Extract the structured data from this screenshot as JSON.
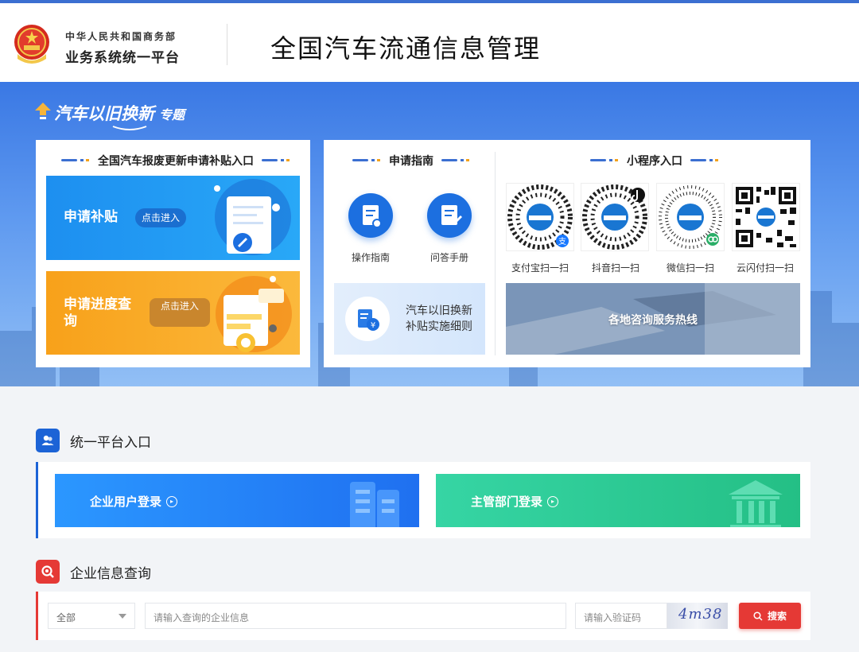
{
  "header": {
    "ministry": "中华人民共和国商务部",
    "platform": "业务系统统一平台",
    "system_title": "全国汽车流通信息管理"
  },
  "banner": {
    "special_title": "汽车以旧换新",
    "special_suffix": "专题",
    "subsidy_section": {
      "title": "全国汽车报废更新申请补贴入口",
      "apply": {
        "label": "申请补贴",
        "action": "点击进入"
      },
      "progress": {
        "label": "申请进度查询",
        "action": "点击进入"
      }
    },
    "guide_section": {
      "title": "申请指南",
      "items": [
        {
          "label": "操作指南",
          "icon": "document-badge-icon"
        },
        {
          "label": "问答手册",
          "icon": "pencil-document-icon"
        }
      ],
      "rules": "汽车以旧换新补贴实施细则"
    },
    "miniapp_section": {
      "title": "小程序入口",
      "items": [
        {
          "label": "支付宝扫一扫",
          "badge_color": "#1677ff"
        },
        {
          "label": "抖音扫一扫",
          "badge_color": "#111111"
        },
        {
          "label": "微信扫一扫",
          "badge_color": "#2aae67"
        },
        {
          "label": "云闪付扫一扫",
          "badge_color": ""
        }
      ],
      "hotline": "各地咨询服务热线"
    }
  },
  "unified_entry": {
    "title": "统一平台入口",
    "enterprise_login": "企业用户登录",
    "authority_login": "主管部门登录"
  },
  "company_query": {
    "title": "企业信息查询",
    "scope_value": "全部",
    "query_placeholder": "请输入查询的企业信息",
    "captcha_placeholder": "请输入验证码",
    "captcha_text": "4m38",
    "search_label": "搜索"
  },
  "colors": {
    "brand_blue": "#1c6fe0",
    "accent_orange": "#f8a11a",
    "accent_green": "#2cc48f",
    "accent_red": "#e53935"
  }
}
